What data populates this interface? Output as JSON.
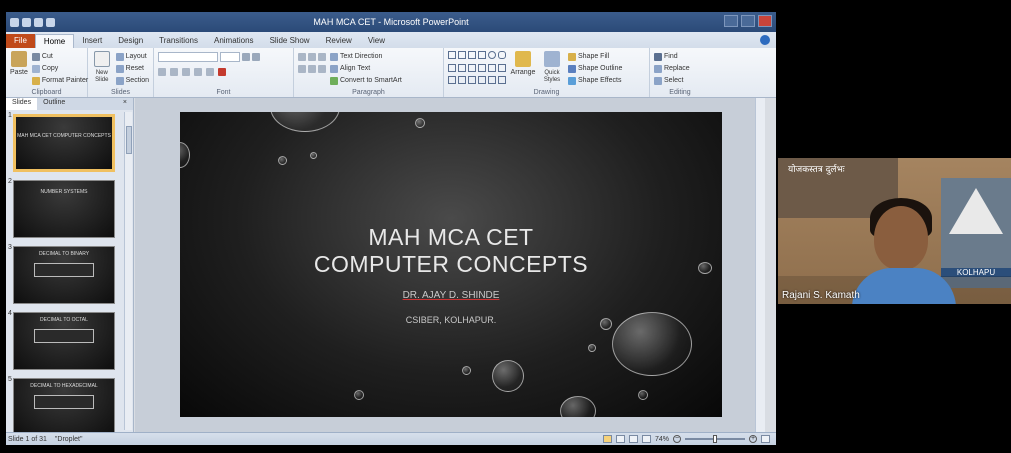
{
  "window": {
    "title": "MAH MCA CET - Microsoft PowerPoint"
  },
  "ribbon": {
    "tabs": [
      "File",
      "Home",
      "Insert",
      "Design",
      "Transitions",
      "Animations",
      "Slide Show",
      "Review",
      "View"
    ],
    "active_tab": "Home",
    "clipboard": {
      "paste": "Paste",
      "cut": "Cut",
      "copy": "Copy",
      "format_painter": "Format Painter",
      "label": "Clipboard"
    },
    "slides": {
      "new_slide": "New Slide",
      "layout": "Layout",
      "reset": "Reset",
      "section": "Section",
      "label": "Slides"
    },
    "font": {
      "label": "Font"
    },
    "paragraph": {
      "text_direction": "Text Direction",
      "align_text": "Align Text",
      "convert_smartart": "Convert to SmartArt",
      "label": "Paragraph"
    },
    "drawing": {
      "arrange": "Arrange",
      "quick_styles": "Quick Styles",
      "shape_fill": "Shape Fill",
      "shape_outline": "Shape Outline",
      "shape_effects": "Shape Effects",
      "label": "Drawing"
    },
    "editing": {
      "find": "Find",
      "replace": "Replace",
      "select": "Select",
      "label": "Editing"
    }
  },
  "left_pane": {
    "tabs": [
      "Slides",
      "Outline"
    ],
    "close": "×",
    "thumbnails": [
      {
        "num": "1",
        "text": "MAH MCA CET COMPUTER CONCEPTS"
      },
      {
        "num": "2",
        "text": "NUMBER SYSTEMS"
      },
      {
        "num": "3",
        "text": "DECIMAL TO BINARY"
      },
      {
        "num": "4",
        "text": "DECIMAL TO OCTAL"
      },
      {
        "num": "5",
        "text": "DECIMAL TO HEXADECIMAL"
      }
    ]
  },
  "slide": {
    "title_line1": "MAH MCA CET",
    "title_line2": "COMPUTER CONCEPTS",
    "author": "DR. AJAY D. SHINDE",
    "institution": "CSIBER, KOLHAPUR."
  },
  "status_bar": {
    "slide_info": "Slide 1 of 31",
    "theme": "\"Droplet\"",
    "zoom": "74%"
  },
  "webcam": {
    "name": "Rajani S. Kamath",
    "poster_text": "योजकस्तत्र दुर्लभः",
    "sign_text": "KOLHAPU"
  },
  "colors": {
    "file_tab": "#c04a1a",
    "titlebar": "#2b4a78",
    "slide_bg": "#1f1f1f"
  }
}
